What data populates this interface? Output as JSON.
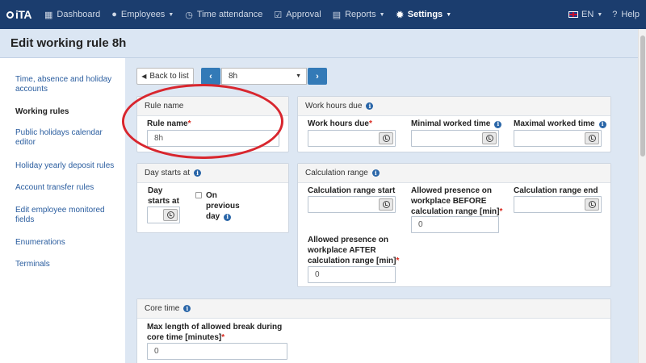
{
  "nav": {
    "logo": "iTA",
    "items": [
      {
        "label": "Dashboard",
        "icon": "grid-icon"
      },
      {
        "label": "Employees",
        "icon": "user-icon",
        "dropdown": true
      },
      {
        "label": "Time attendance",
        "icon": "clock-icon"
      },
      {
        "label": "Approval",
        "icon": "checkbox-icon"
      },
      {
        "label": "Reports",
        "icon": "printer-icon",
        "dropdown": true
      },
      {
        "label": "Settings",
        "icon": "gear-icon",
        "dropdown": true,
        "active": true
      }
    ],
    "language": "EN",
    "help": "Help"
  },
  "page": {
    "title": "Edit working rule 8h"
  },
  "sidebar": {
    "items": [
      {
        "label": "Time, absence and holiday accounts"
      },
      {
        "label": "Working rules",
        "active": true
      },
      {
        "label": "Public holidays calendar editor"
      },
      {
        "label": "Holiday yearly deposit rules"
      },
      {
        "label": "Account transfer rules"
      },
      {
        "label": "Edit employee monitored fields"
      },
      {
        "label": "Enumerations"
      },
      {
        "label": "Terminals"
      }
    ]
  },
  "toolbar": {
    "back_label": "Back to list",
    "selected_rule": "8h"
  },
  "rule_name_panel": {
    "heading": "Rule name",
    "label": "Rule name",
    "value": "8h"
  },
  "work_hours_panel": {
    "heading": "Work hours due",
    "fields": {
      "due": "Work hours due",
      "min": "Minimal worked time",
      "max": "Maximal worked time"
    }
  },
  "day_starts_panel": {
    "heading": "Day starts at",
    "label_line1": "Day",
    "label_line2": "starts at",
    "checkbox_line1": "On",
    "checkbox_line2": "previous",
    "checkbox_line3": "day"
  },
  "calc_range_panel": {
    "heading": "Calculation range",
    "start_label": "Calculation range start",
    "before_line1": "Allowed presence on",
    "before_line2": "workplace BEFORE",
    "before_line3": "calculation range [min]",
    "before_value": "0",
    "end_label": "Calculation range end",
    "after_line1": "Allowed presence on",
    "after_line2": "workplace AFTER",
    "after_line3": "calculation range [min]",
    "after_value": "0"
  },
  "core_time_panel": {
    "heading": "Core time",
    "label_line1": "Max length of allowed break during",
    "label_line2": "core time [minutes]",
    "value": "0"
  },
  "colors": {
    "nav": "#1b3d6e",
    "accent": "#337ab7",
    "required": "#d9261c",
    "highlight": "#d8262e"
  }
}
